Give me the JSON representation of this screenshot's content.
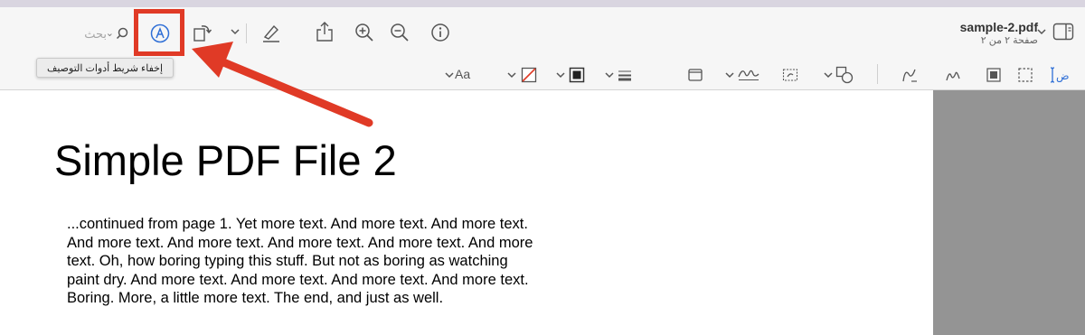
{
  "window": {
    "title": "sample-2.pdf",
    "subtitle": "صفحة ٢ من ٢"
  },
  "toolbar": {
    "search_placeholder": "بحث",
    "tooltip": "إخفاء شريط أدوات التوصيف",
    "icons": [
      "sidebar-icon",
      "chevron-down-icon",
      "info-icon",
      "zoom-out-icon",
      "zoom-in-icon",
      "share-icon",
      "highlight-icon",
      "rotate-chevron-icon",
      "rotate-icon",
      "markup-icon",
      "search-icon"
    ],
    "accent": "#2f6fd6",
    "annotation_color": "#e03a26"
  },
  "markup": {
    "text_style_label": "Aa",
    "icons": [
      "text-tool-icon",
      "sketch-icon",
      "draw-icon",
      "shapes-icon",
      "rectangle-selection-icon",
      "shape-icon",
      "text-box-icon",
      "signature-icon",
      "page-icon",
      "lines-icon",
      "border-color-icon",
      "fill-color-icon",
      "text-style-icon"
    ]
  },
  "document": {
    "heading": "Simple PDF File 2",
    "lines": [
      "...continued from page 1. Yet more text. And more text. And more text.",
      "And more text. And more text. And more text. And more text. And more",
      "text. Oh, how boring typing this stuff. But not as boring as watching",
      "paint dry. And more text. And more text. And more text. And more text.",
      "Boring.  More, a little more text. The end, and just as well."
    ]
  }
}
